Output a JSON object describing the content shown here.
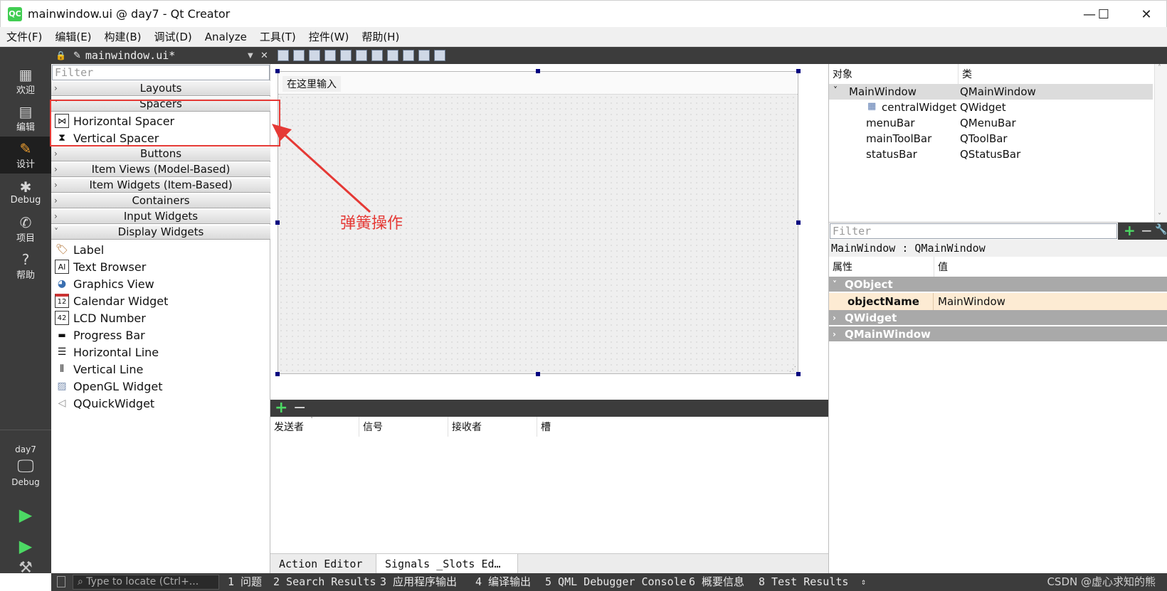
{
  "window": {
    "title": "mainwindow.ui @ day7 - Qt Creator",
    "app_icon_text": "QC",
    "minimize": "—",
    "maximize": "☐",
    "close": "✕"
  },
  "menubar": [
    "文件(F)",
    "编辑(E)",
    "构建(B)",
    "调试(D)",
    "Analyze",
    "工具(T)",
    "控件(W)",
    "帮助(H)"
  ],
  "modes": [
    {
      "label": "欢迎",
      "icon": "grid-icon"
    },
    {
      "label": "编辑",
      "icon": "document-icon"
    },
    {
      "label": "设计",
      "icon": "pencil-icon"
    },
    {
      "label": "Debug",
      "icon": "bug-icon"
    },
    {
      "label": "项目",
      "icon": "wrench-icon"
    },
    {
      "label": "帮助",
      "icon": "help-icon"
    }
  ],
  "kit": {
    "project": "day7",
    "build": "Debug"
  },
  "document": {
    "name": "mainwindow.ui*",
    "close": "✕"
  },
  "widgetbox": {
    "filter_placeholder": "Filter",
    "categories": [
      "Layouts",
      "Spacers",
      "Buttons",
      "Item Views (Model-Based)",
      "Item Widgets (Item-Based)",
      "Containers",
      "Input Widgets",
      "Display Widgets"
    ],
    "spacers": [
      "Horizontal Spacer",
      "Vertical Spacer"
    ],
    "display_widgets": [
      "Label",
      "Text Browser",
      "Graphics View",
      "Calendar Widget",
      "LCD Number",
      "Progress Bar",
      "Horizontal Line",
      "Vertical Line",
      "OpenGL Widget",
      "QQuickWidget"
    ]
  },
  "form": {
    "menu_placeholder": "在这里输入"
  },
  "annotation": {
    "text": "弹簧操作",
    "color": "#e53935"
  },
  "signals": {
    "columns": [
      "发送者",
      "信号",
      "接收者",
      "槽"
    ],
    "add": "+",
    "remove": "−"
  },
  "bottom_tabs": [
    "Action Editor",
    "Signals _Slots Ed…"
  ],
  "object_inspector": {
    "columns": [
      "对象",
      "类"
    ],
    "rows": [
      {
        "object": "MainWindow",
        "class": "QMainWindow"
      },
      {
        "object": "centralWidget",
        "class": "QWidget"
      },
      {
        "object": "menuBar",
        "class": "QMenuBar"
      },
      {
        "object": "mainToolBar",
        "class": "QToolBar"
      },
      {
        "object": "statusBar",
        "class": "QStatusBar"
      }
    ]
  },
  "property_editor": {
    "filter_placeholder": "Filter",
    "class_line": "MainWindow : QMainWindow",
    "columns": [
      "属性",
      "值"
    ],
    "groups": [
      "QObject",
      "QWidget",
      "QMainWindow"
    ],
    "object_name": {
      "property": "objectName",
      "value": "MainWindow"
    }
  },
  "statusbar": {
    "locator_placeholder": "Type to locate (Ctrl+...",
    "panes": [
      "1 问题",
      "2 Search Results",
      "3 应用程序输出",
      "4 编译输出",
      "5 QML Debugger Console",
      "6 概要信息",
      "8 Test Results"
    ],
    "watermark": "CSDN @虚心求知的熊"
  },
  "colors": {
    "accent_green": "#4cd964",
    "dark_panel": "#3c3c3c",
    "highlight": "#e53935",
    "group_gray": "#a9a9a9"
  }
}
